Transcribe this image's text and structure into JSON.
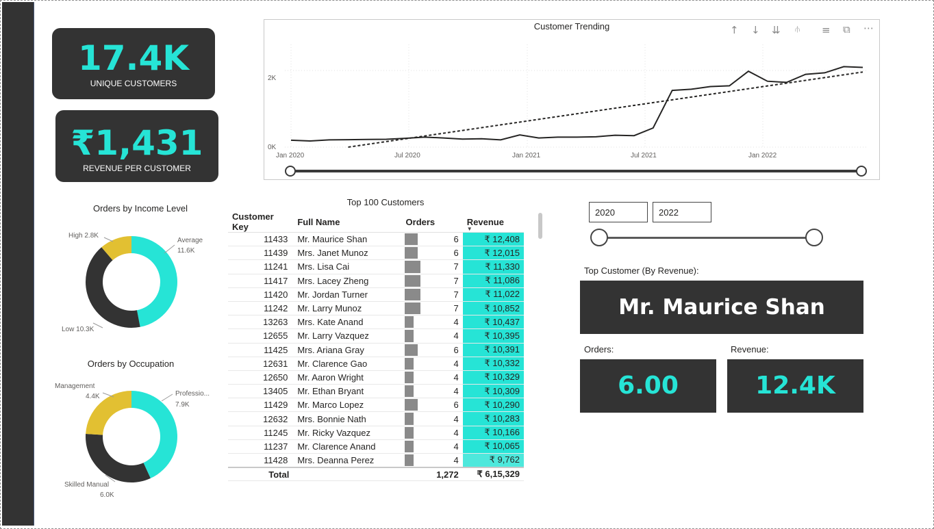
{
  "kpis": {
    "unique_customers": {
      "value": "17.4K",
      "label": "UNIQUE CUSTOMERS"
    },
    "revenue_per_customer": {
      "value": "₹1,431",
      "label": "REVENUE PER CUSTOMER"
    }
  },
  "trend": {
    "title": "Customer Trending",
    "toolbar_icons": [
      "arrow-up-icon",
      "arrow-down-icon",
      "double-arrow-down-icon",
      "expand-hierarchy-icon",
      "filter-icon",
      "focus-mode-icon",
      "more-options-icon"
    ],
    "y_ticks": [
      "2K",
      "0K"
    ],
    "x_ticks": [
      "Jan 2020",
      "Jul 2020",
      "Jan 2021",
      "Jul 2021",
      "Jan 2022"
    ]
  },
  "chart_data": [
    {
      "type": "line",
      "title": "Customer Trending",
      "x": [
        "2020-01",
        "2020-02",
        "2020-03",
        "2020-04",
        "2020-05",
        "2020-06",
        "2020-07",
        "2020-08",
        "2020-09",
        "2020-10",
        "2020-11",
        "2020-12",
        "2021-01",
        "2021-02",
        "2021-03",
        "2021-04",
        "2021-05",
        "2021-06",
        "2021-07",
        "2021-08",
        "2021-09",
        "2021-10",
        "2021-11",
        "2021-12",
        "2022-01",
        "2022-02",
        "2022-03",
        "2022-04",
        "2022-05",
        "2022-06"
      ],
      "series": [
        {
          "values": [
            180,
            160,
            190,
            195,
            200,
            205,
            230,
            260,
            240,
            210,
            220,
            190,
            320,
            240,
            260,
            260,
            270,
            310,
            300,
            500,
            1480,
            1510,
            1580,
            1600,
            1980,
            1720,
            1690,
            1900,
            1940,
            2100,
            2080
          ]
        }
      ],
      "trend_line": {
        "style": "dashed",
        "start": [
          "2020-04",
          0
        ],
        "end": [
          "2022-06",
          1960
        ]
      },
      "ylim": [
        0,
        2500
      ],
      "grid": true
    },
    {
      "type": "pie",
      "title": "Orders by Income Level",
      "labels": [
        "Average",
        "Low",
        "High"
      ],
      "values": [
        11.6,
        10.3,
        2.8
      ],
      "value_labels": [
        "11.6K",
        "10.3K",
        "2.8K"
      ],
      "colors": [
        "#26e4d6",
        "#333333",
        "#e2c032"
      ]
    },
    {
      "type": "pie",
      "title": "Orders by Occupation",
      "labels": [
        "Professio...",
        "Skilled Manual",
        "Management"
      ],
      "values": [
        7.9,
        6.0,
        4.4
      ],
      "value_labels": [
        "7.9K",
        "6.0K",
        "4.4K"
      ],
      "colors": [
        "#26e4d6",
        "#333333",
        "#e2c032"
      ]
    }
  ],
  "table": {
    "title": "Top 100 Customers",
    "columns": [
      "Customer Key",
      "Full Name",
      "Orders",
      "Revenue"
    ],
    "rows": [
      {
        "key": "11433",
        "name": "Mr. Maurice Shan",
        "orders": 6,
        "revenue": "₹ 12,408"
      },
      {
        "key": "11439",
        "name": "Mrs. Janet Munoz",
        "orders": 6,
        "revenue": "₹ 12,015"
      },
      {
        "key": "11241",
        "name": "Mrs. Lisa Cai",
        "orders": 7,
        "revenue": "₹ 11,330"
      },
      {
        "key": "11417",
        "name": "Mrs. Lacey Zheng",
        "orders": 7,
        "revenue": "₹ 11,086"
      },
      {
        "key": "11420",
        "name": "Mr. Jordan Turner",
        "orders": 7,
        "revenue": "₹ 11,022"
      },
      {
        "key": "11242",
        "name": "Mr. Larry Munoz",
        "orders": 7,
        "revenue": "₹ 10,852"
      },
      {
        "key": "13263",
        "name": "Mrs. Kate Anand",
        "orders": 4,
        "revenue": "₹ 10,437"
      },
      {
        "key": "12655",
        "name": "Mr. Larry Vazquez",
        "orders": 4,
        "revenue": "₹ 10,395"
      },
      {
        "key": "11425",
        "name": "Mrs. Ariana Gray",
        "orders": 6,
        "revenue": "₹ 10,391"
      },
      {
        "key": "12631",
        "name": "Mr. Clarence Gao",
        "orders": 4,
        "revenue": "₹ 10,332"
      },
      {
        "key": "12650",
        "name": "Mr. Aaron Wright",
        "orders": 4,
        "revenue": "₹ 10,329"
      },
      {
        "key": "13405",
        "name": "Mr. Ethan Bryant",
        "orders": 4,
        "revenue": "₹ 10,309"
      },
      {
        "key": "11429",
        "name": "Mr. Marco Lopez",
        "orders": 6,
        "revenue": "₹ 10,290"
      },
      {
        "key": "12632",
        "name": "Mrs. Bonnie Nath",
        "orders": 4,
        "revenue": "₹ 10,283"
      },
      {
        "key": "11245",
        "name": "Mr. Ricky Vazquez",
        "orders": 4,
        "revenue": "₹ 10,166"
      },
      {
        "key": "11237",
        "name": "Mr. Clarence Anand",
        "orders": 4,
        "revenue": "₹ 10,065"
      },
      {
        "key": "11428",
        "name": "Mrs. Deanna Perez",
        "orders": 4,
        "revenue": "₹ 9,762"
      }
    ],
    "total": {
      "label": "Total",
      "orders": "1,272",
      "revenue": "₹ 6,15,329"
    }
  },
  "year_filter": {
    "start": "2020",
    "end": "2022"
  },
  "top_customer": {
    "label": "Top Customer (By Revenue):",
    "name": "Mr. Maurice Shan",
    "orders_label": "Orders:",
    "orders_value": "6.00",
    "revenue_label": "Revenue:",
    "revenue_value": "12.4K"
  },
  "colors": {
    "accent": "#26e4d6",
    "dark": "#333333",
    "yellow": "#e2c032"
  }
}
